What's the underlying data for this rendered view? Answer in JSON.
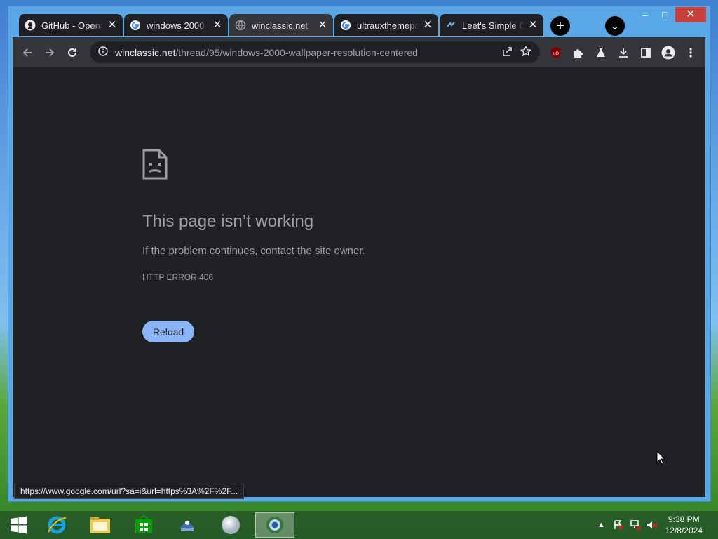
{
  "browser": {
    "tabs": [
      {
        "title": "GitHub - OpenShell-...",
        "icon": "github-icon",
        "active": false
      },
      {
        "title": "windows 2000 ...",
        "icon": "google-icon",
        "active": false
      },
      {
        "title": "winclassic.net",
        "icon": "globe-icon",
        "active": true
      },
      {
        "title": "ultrauxthemepatcher",
        "icon": "google-icon",
        "active": false
      },
      {
        "title": "Leet's Simple Cl...",
        "icon": "site-icon",
        "active": false
      }
    ],
    "new_tab_symbol": "+",
    "tab_search_symbol": "⌄",
    "window_controls": {
      "minimize": "–",
      "maximize": "□",
      "close": "✕"
    },
    "address": {
      "host": "winclassic.net",
      "path": "/thread/95/windows-2000-wallpaper-resolution-centered"
    },
    "extensions": [
      "ublock-icon",
      "puzzle-icon",
      "labs-icon",
      "download-icon",
      "sidepanel-icon",
      "profile-icon",
      "menu-icon"
    ]
  },
  "error_page": {
    "title": "This page isn’t working",
    "message": "If the problem continues, contact the site owner.",
    "code": "HTTP ERROR 406",
    "reload_label": "Reload"
  },
  "status_bubble": "https://www.google.com/url?sa=i&url=https%3A%2F%2F...",
  "taskbar": {
    "apps": [
      "start-icon",
      "ie-icon",
      "explorer-icon",
      "store-icon",
      "network-app-icon",
      "sphere-app-icon",
      "chrome-classic-icon"
    ],
    "clock_time": "9:38 PM",
    "clock_date": "12/8/2024"
  },
  "colors": {
    "content_bg": "#202124",
    "toolbar_bg": "#35363a",
    "reload_bg": "#8ab4f8",
    "text_muted": "#9aa0a6"
  }
}
